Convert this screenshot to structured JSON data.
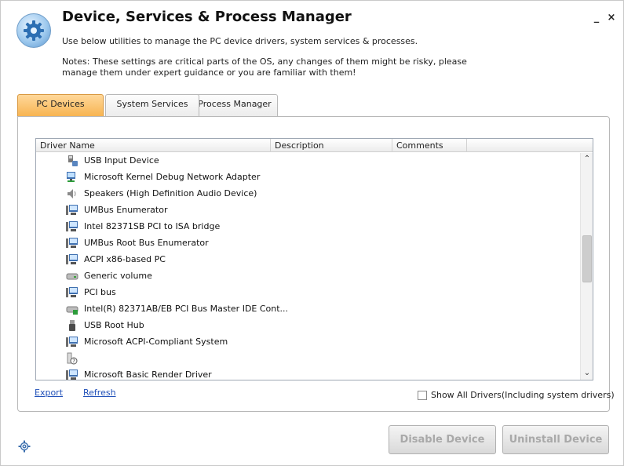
{
  "window": {
    "title": "Device, Services & Process Manager",
    "subtitle": "Use below utilities to manage the PC device drivers, system services & processes.",
    "notes": "Notes: These settings are critical parts of the OS, any changes of them might be risky, please manage them under expert guidance or you are familiar with them!",
    "controls": {
      "minimize": "_",
      "close": "×"
    }
  },
  "tabs": [
    {
      "label": "PC Devices",
      "active": true
    },
    {
      "label": "System Services",
      "active": false
    },
    {
      "label": "Process Manager",
      "active": false
    }
  ],
  "grid": {
    "columns": [
      "Driver Name",
      "Description",
      "Comments"
    ],
    "rows": [
      {
        "name": "USB Input Device",
        "icon": "usb-input-device-icon"
      },
      {
        "name": "Microsoft Kernel Debug Network Adapter",
        "icon": "network-adapter-icon"
      },
      {
        "name": "Speakers (High Definition Audio Device)",
        "icon": "speaker-icon"
      },
      {
        "name": "UMBus Enumerator",
        "icon": "system-device-icon"
      },
      {
        "name": "Intel 82371SB PCI to ISA bridge",
        "icon": "system-device-icon"
      },
      {
        "name": "UMBus Root Bus Enumerator",
        "icon": "system-device-icon"
      },
      {
        "name": "ACPI x86-based PC",
        "icon": "computer-icon"
      },
      {
        "name": "Generic volume",
        "icon": "drive-icon"
      },
      {
        "name": "PCI bus",
        "icon": "system-device-icon"
      },
      {
        "name": "Intel(R) 82371AB/EB PCI Bus Master IDE Cont...",
        "icon": "ide-controller-icon"
      },
      {
        "name": "USB Root Hub",
        "icon": "usb-icon"
      },
      {
        "name": "Microsoft ACPI-Compliant System",
        "icon": "system-device-icon"
      },
      {
        "name": "",
        "icon": "unknown-device-icon"
      },
      {
        "name": "Microsoft Basic Render Driver",
        "icon": "system-device-icon"
      }
    ],
    "scroll_position": 0.45
  },
  "links": {
    "export": "Export",
    "refresh": "Refresh"
  },
  "show_all": {
    "label": "Show All Drivers(Including system drivers)",
    "checked": false
  },
  "buttons": {
    "disable": "Disable Device",
    "uninstall": "Uninstall Device"
  },
  "colors": {
    "active_tab": "#f7b451",
    "link": "#1f4fb8",
    "disabled_text": "#a9a9a9"
  }
}
